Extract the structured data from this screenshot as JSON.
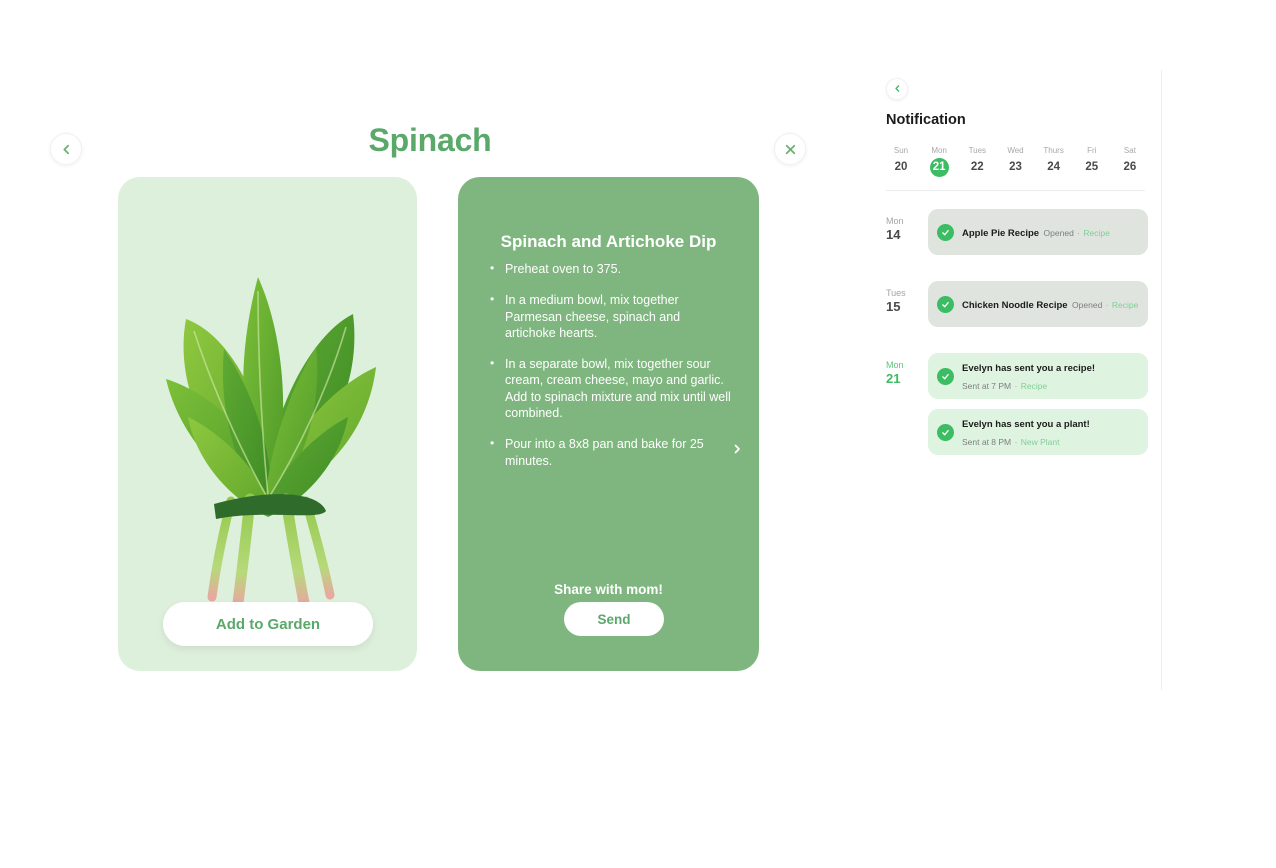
{
  "detail": {
    "title": "Spinach",
    "back_icon": "chevron-left-icon",
    "close_icon": "close-icon",
    "image_card": {
      "subject": "spinach-bunch-photo",
      "background_color": "#ddf0dc",
      "add_button_label": "Add to Garden"
    },
    "recipe": {
      "title": "Spinach and Artichoke Dip",
      "card_color": "#7fb67f",
      "next_icon": "chevron-right-icon",
      "steps": [
        "Preheat oven to 375.",
        "In a medium bowl, mix together Parmesan cheese, spinach and artichoke hearts.",
        "In a separate bowl, mix together sour cream, cream cheese, mayo and garlic. Add to spinach mixture and mix until well combined.",
        "Pour into a 8x8 pan and bake for 25 minutes."
      ],
      "share_label": "Share with mom!",
      "send_label": "Send"
    }
  },
  "notifications": {
    "back_icon": "chevron-left-icon",
    "title": "Notification",
    "accent_color": "#3cbc63",
    "week": [
      {
        "name": "Sun",
        "num": "20",
        "active": false
      },
      {
        "name": "Mon",
        "num": "21",
        "active": true
      },
      {
        "name": "Tues",
        "num": "22",
        "active": false
      },
      {
        "name": "Wed",
        "num": "23",
        "active": false
      },
      {
        "name": "Thurs",
        "num": "24",
        "active": false
      },
      {
        "name": "Fri",
        "num": "25",
        "active": false
      },
      {
        "name": "Sat",
        "num": "26",
        "active": false
      }
    ],
    "groups": [
      {
        "day": "Mon",
        "num": "14",
        "highlight": false,
        "items": [
          {
            "title": "Apple Pie Recipe",
            "status": "Opened",
            "tag": "Recipe",
            "state": "read",
            "icon": "check-circle-icon"
          }
        ]
      },
      {
        "day": "Tues",
        "num": "15",
        "highlight": false,
        "items": [
          {
            "title": "Chicken Noodle Recipe",
            "status": "Opened",
            "tag": "Recipe",
            "state": "read",
            "icon": "check-circle-icon"
          }
        ]
      },
      {
        "day": "Mon",
        "num": "21",
        "highlight": true,
        "items": [
          {
            "title": "Evelyn has sent you a recipe!",
            "status": "Sent at 7 PM",
            "tag": "Recipe",
            "state": "unread",
            "icon": "check-circle-icon"
          },
          {
            "title": "Evelyn has sent you a plant!",
            "status": "Sent at 8 PM",
            "tag": "New Plant",
            "state": "unread",
            "icon": "check-circle-icon"
          }
        ]
      }
    ]
  }
}
